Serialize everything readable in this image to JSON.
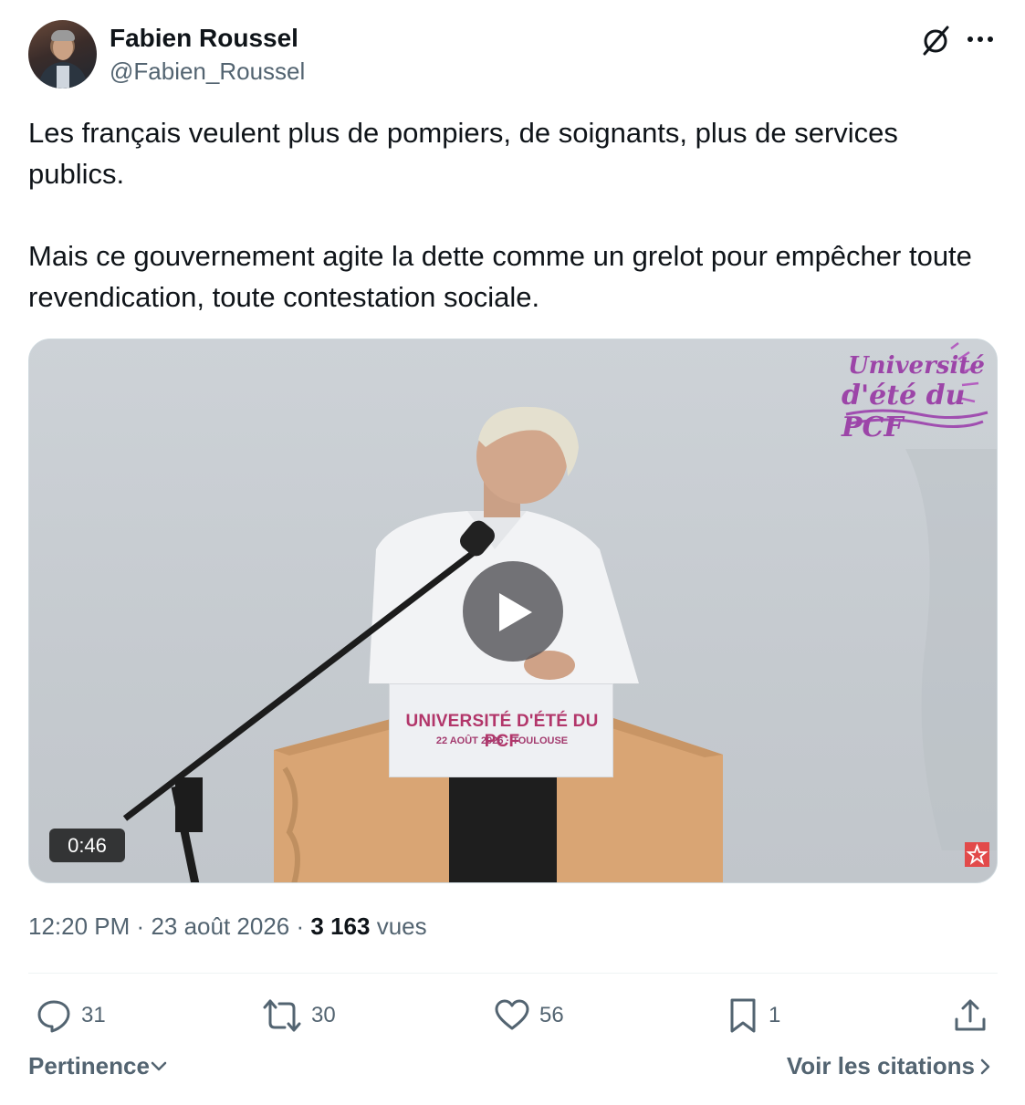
{
  "author": {
    "name": "Fabien Roussel",
    "handle": "@Fabien_Roussel",
    "avatar_icon": "profile-photo"
  },
  "header_icons": {
    "grok": "grok-icon",
    "more": "more-options-icon"
  },
  "tweet": {
    "text": "Les français veulent plus de pompiers, de soignants, plus de services publics.\n\nMais ce gouvernement agite la dette comme un grelot pour empêcher toute revendication, toute contestation sociale."
  },
  "media": {
    "type": "video",
    "duration": "0:46",
    "overlay_logo_line1": "Université",
    "overlay_logo_line2": "d'été du PCF",
    "sign_title": "UNIVERSITÉ D'ÉTÉ DU PCF",
    "sign_subtitle": "22 AOÛT 2026 · TOULOUSE",
    "play_icon": "play-icon"
  },
  "meta": {
    "time": "12:20 PM",
    "date": "23 août 2026",
    "views_count": "3 163",
    "views_label": "vues",
    "separator": "·"
  },
  "actions": {
    "replies": "31",
    "reposts": "30",
    "likes": "56",
    "bookmarks": "1"
  },
  "footer": {
    "sort_label": "Pertinence",
    "quotes_label": "Voir les citations"
  },
  "colors": {
    "text_primary": "#0f1419",
    "text_secondary": "#536471",
    "border": "#cfd9de",
    "logo_purple": "#9c45a8",
    "sign_red": "#b2366a"
  }
}
